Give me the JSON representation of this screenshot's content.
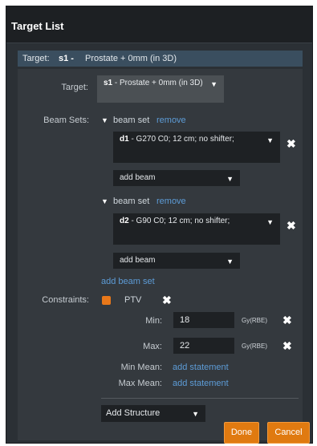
{
  "panel": {
    "title": "Target List"
  },
  "target_bar": {
    "label": "Target:",
    "code": "s1 -",
    "value": "Prostate + 0mm (in 3D)"
  },
  "target": {
    "label": "Target:",
    "selected_code": "s1",
    "selected_text": " - Prostate + 0mm (in 3D)"
  },
  "beam_sets": {
    "label": "Beam Sets:",
    "items": [
      {
        "title": "beam set",
        "remove": "remove",
        "beam_code": "d1",
        "beam_text": " - G270 C0; 12 cm; no shifter;",
        "add_beam": "add beam"
      },
      {
        "title": "beam set",
        "remove": "remove",
        "beam_code": "d2",
        "beam_text": " - G90 C0; 12 cm; no shifter;",
        "add_beam": "add beam"
      }
    ],
    "add_beam_set": "add beam set"
  },
  "constraints": {
    "label": "Constraints:",
    "structure": "PTV",
    "structure_color": "#e8781a",
    "min_label": "Min:",
    "min_value": "18",
    "max_label": "Max:",
    "max_value": "22",
    "unit": "Gy(RBE)",
    "min_mean_label": "Min Mean:",
    "max_mean_label": "Max Mean:",
    "add_statement": "add statement"
  },
  "add_structure": "Add Structure",
  "buttons": {
    "done": "Done",
    "cancel": "Cancel"
  },
  "icons": {
    "dropdown": "caret-down-icon",
    "expand": "triangle-down-icon",
    "delete": "close-x-icon"
  }
}
